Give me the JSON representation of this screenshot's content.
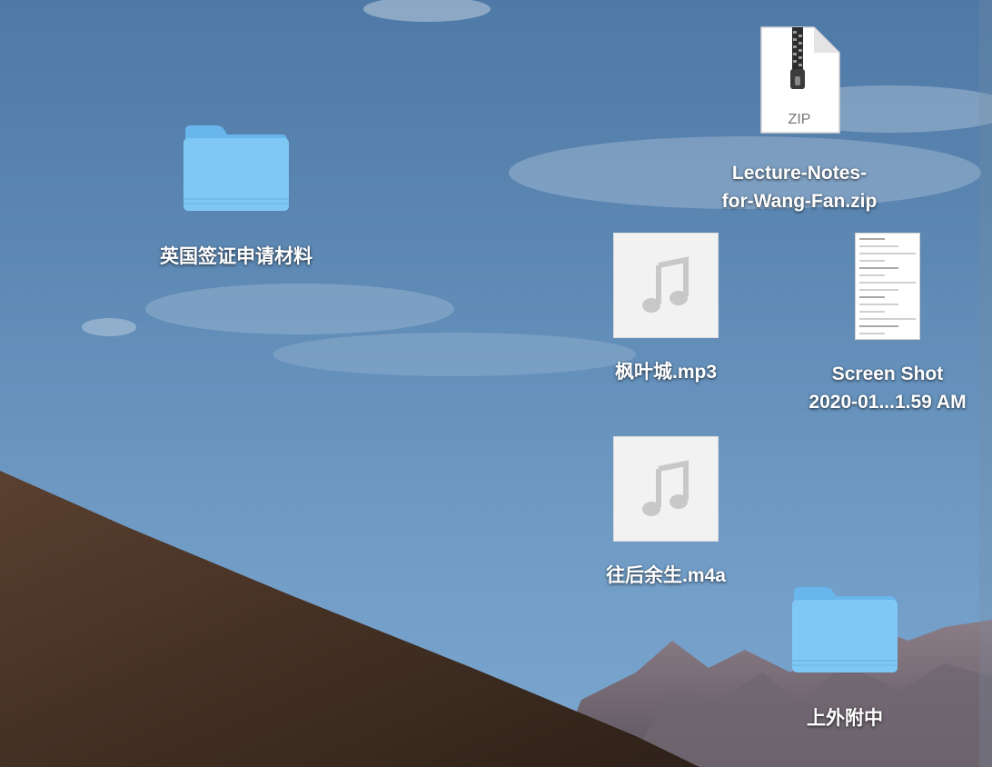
{
  "desktop": {
    "icons": [
      {
        "label": "英国签证申请材料",
        "kind": "folder"
      },
      {
        "label_lines": [
          "Lecture-Notes-",
          "for-Wang-Fan.zip"
        ],
        "kind": "zip",
        "badge": "ZIP"
      },
      {
        "label": "枫叶城.mp3",
        "kind": "audio"
      },
      {
        "label_lines": [
          "Screen Shot",
          "2020-01...1.59 AM"
        ],
        "kind": "screenshot"
      },
      {
        "label": "往后余生.m4a",
        "kind": "audio"
      },
      {
        "label": "上外附中",
        "kind": "folder"
      }
    ]
  },
  "colors": {
    "folder_front": "#7ec6f5",
    "folder_back": "#6ab8ee",
    "sky_top": "#4f79a6",
    "dune": "#4a3526"
  }
}
